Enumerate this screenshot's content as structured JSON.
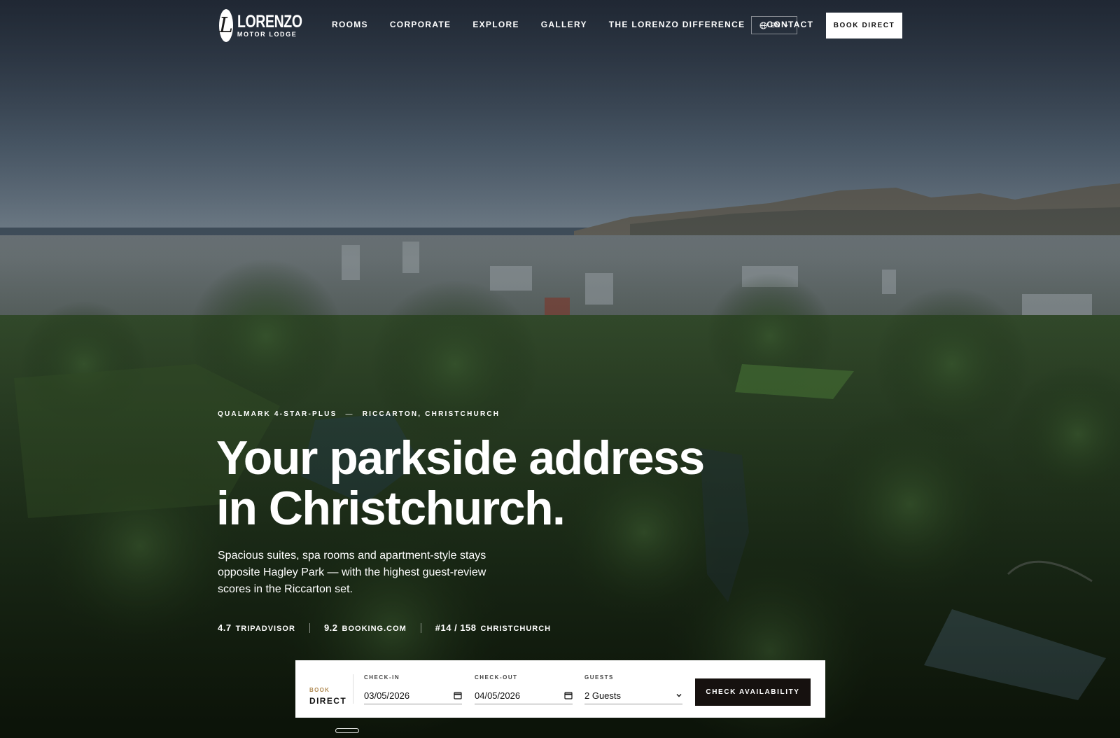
{
  "brand": {
    "name": "LORENZO",
    "tagline": "MOTOR LODGE",
    "monogram": "L"
  },
  "nav": {
    "links": [
      "ROOMS",
      "CORPORATE",
      "EXPLORE",
      "GALLERY",
      "THE LORENZO DIFFERENCE",
      "CONTACT"
    ],
    "language": "EN",
    "book_label": "BOOK DIRECT"
  },
  "hero": {
    "eyebrow_left": "QUALMARK 4-STAR-PLUS",
    "eyebrow_sep": "—",
    "eyebrow_right": "RICCARTON, CHRISTCHURCH",
    "headline_line1": "Your parkside address",
    "headline_line2": "in Christchurch.",
    "lead": "Spacious suites, spa rooms and apartment-style stays opposite Hagley Park — with the highest guest-review scores in the Riccarton set.",
    "ratings": [
      {
        "score": "4.7",
        "source": "TRIPADVISOR"
      },
      {
        "score": "9.2",
        "source": "BOOKING.COM"
      },
      {
        "score": "#14 / 158",
        "source": "CHRISTCHURCH"
      }
    ]
  },
  "booking": {
    "title_small": "BOOK",
    "title_big": "DIRECT",
    "checkin_label": "CHECK-IN",
    "checkin_value": "03/05/2026",
    "checkout_label": "CHECK-OUT",
    "checkout_value": "04/05/2026",
    "guests_label": "GUESTS",
    "guests_value": "2 Guests",
    "submit_label": "CHECK AVAILABILITY"
  },
  "colors": {
    "accent": "#b08a52",
    "button_dark": "#16110f"
  }
}
